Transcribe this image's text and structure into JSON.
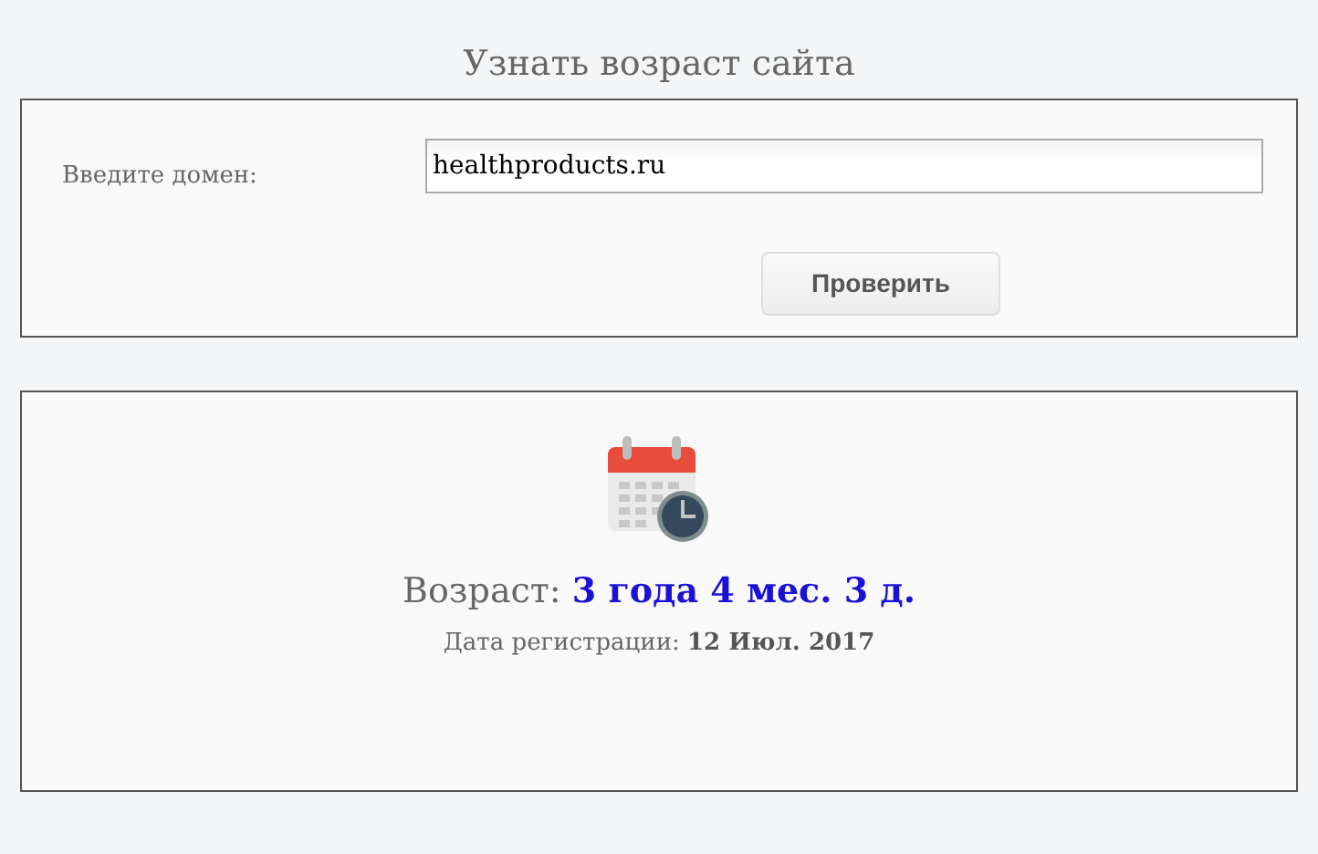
{
  "title": "Узнать возраст сайта",
  "form": {
    "label": "Введите домен:",
    "domain": "healthproducts.ru",
    "button": "Проверить"
  },
  "result": {
    "age": "Возраст: **3 года 4 мес. 3 д.**",
    "registration": "Дата регистрации: **12 Июл. 2017**"
  }
}
